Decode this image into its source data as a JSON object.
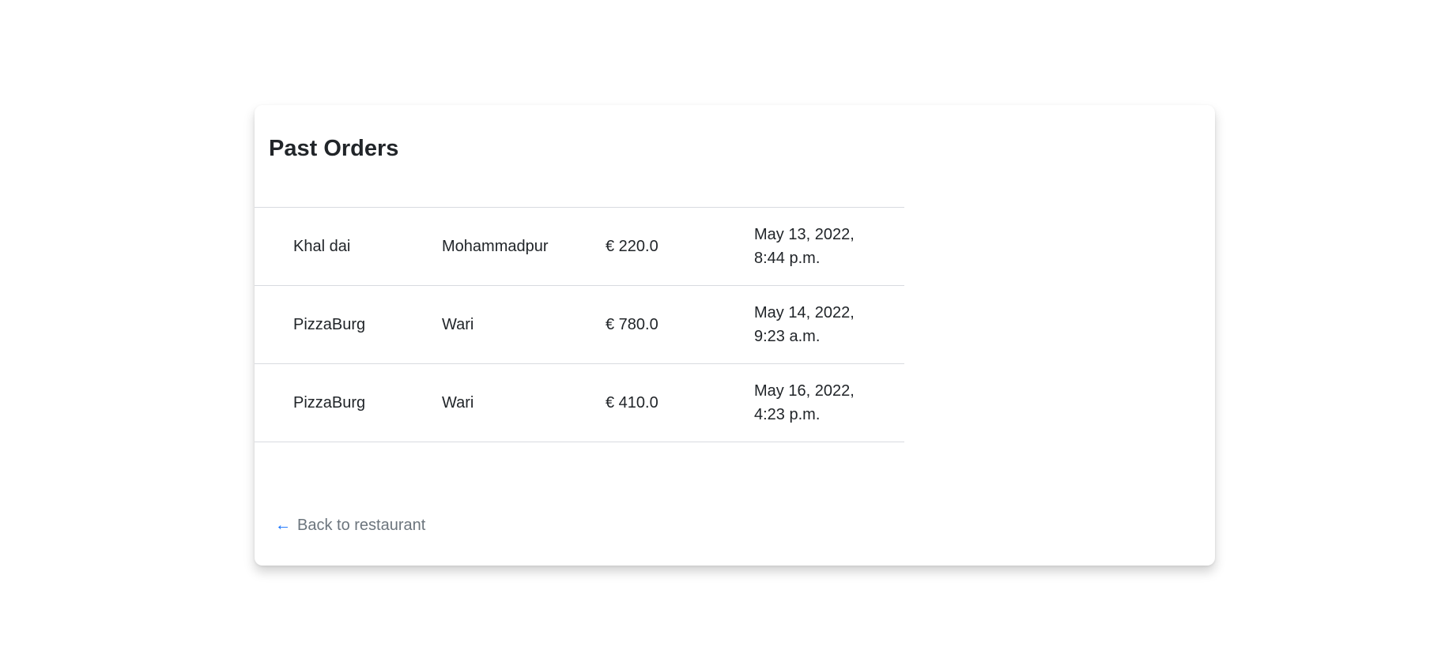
{
  "page": {
    "title": "Past Orders"
  },
  "orders": [
    {
      "restaurant": "Khal dai",
      "area": "Mohammadpur",
      "price": "€ 220.0",
      "date": "May 13, 2022, 8:44 p.m."
    },
    {
      "restaurant": "PizzaBurg",
      "area": "Wari",
      "price": "€ 780.0",
      "date": "May 14, 2022, 9:23 a.m."
    },
    {
      "restaurant": "PizzaBurg",
      "area": "Wari",
      "price": "€ 410.0",
      "date": "May 16, 2022, 4:23 p.m."
    }
  ],
  "footer": {
    "back_arrow": "←",
    "back_label": "Back to restaurant"
  },
  "icons": {
    "back": "arrow-left-icon"
  },
  "colors": {
    "link": "#6c757d",
    "arrow": "#0d6efd",
    "divider": "#d8dbe0"
  }
}
